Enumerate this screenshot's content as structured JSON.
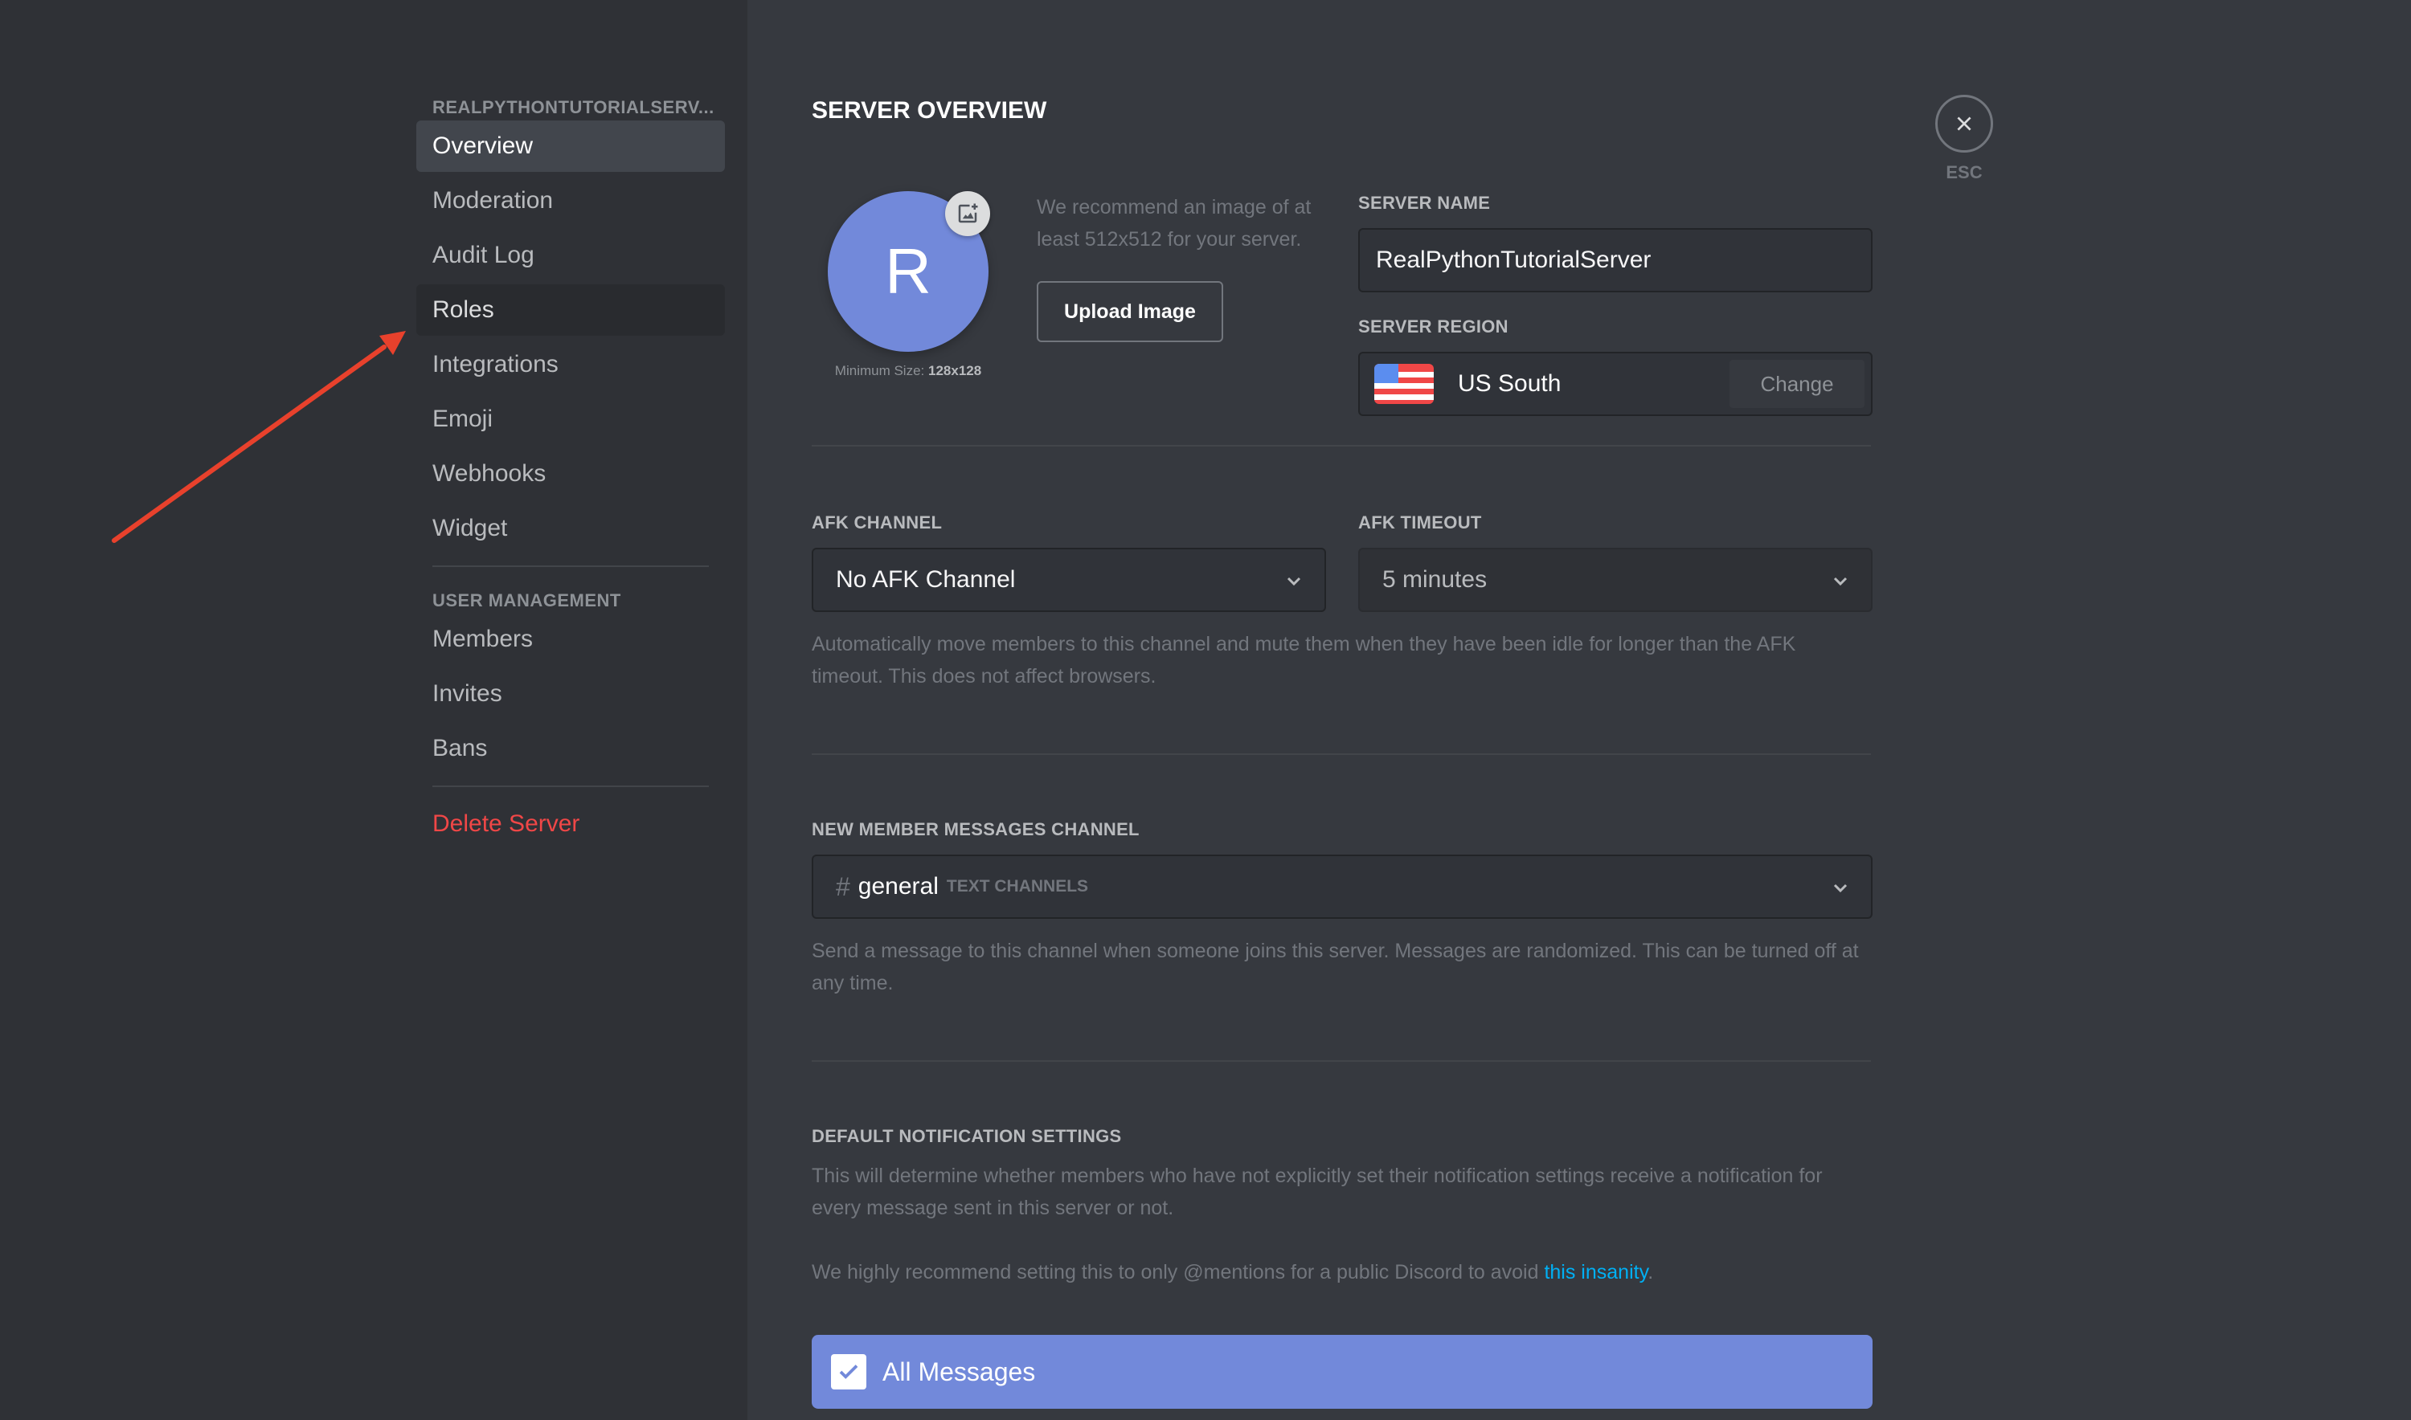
{
  "sidebar": {
    "server_header": "REALPYTHONTUTORIALSERV...",
    "items": [
      {
        "label": "Overview",
        "state": "selected"
      },
      {
        "label": "Moderation",
        "state": ""
      },
      {
        "label": "Audit Log",
        "state": ""
      },
      {
        "label": "Roles",
        "state": "hovered"
      },
      {
        "label": "Integrations",
        "state": ""
      },
      {
        "label": "Emoji",
        "state": ""
      },
      {
        "label": "Webhooks",
        "state": ""
      },
      {
        "label": "Widget",
        "state": ""
      }
    ],
    "user_management_header": "USER MANAGEMENT",
    "user_items": [
      {
        "label": "Members"
      },
      {
        "label": "Invites"
      },
      {
        "label": "Bans"
      }
    ],
    "delete_server": "Delete Server"
  },
  "main": {
    "title": "SERVER OVERVIEW",
    "avatar": {
      "initial": "R",
      "color": "#7289da",
      "upload_icon": "add-image-icon",
      "min_size_label": "Minimum Size:",
      "min_size_value": "128x128"
    },
    "upload": {
      "hint": "We recommend an image of at least 512x512 for your server.",
      "button": "Upload Image"
    },
    "server_name": {
      "label": "SERVER NAME",
      "value": "RealPythonTutorialServer"
    },
    "server_region": {
      "label": "SERVER REGION",
      "flag_icon": "us-flag-icon",
      "value": "US South",
      "change_button": "Change"
    },
    "afk": {
      "channel_label": "AFK CHANNEL",
      "channel_value": "No AFK Channel",
      "timeout_label": "AFK TIMEOUT",
      "timeout_value": "5 minutes",
      "help": "Automatically move members to this channel and mute them when they have been idle for longer than the AFK timeout. This does not affect browsers."
    },
    "new_member": {
      "label": "NEW MEMBER MESSAGES CHANNEL",
      "hash": "#",
      "channel": "general",
      "category": "TEXT CHANNELS",
      "help": "Send a message to this channel when someone joins this server. Messages are randomized. This can be turned off at any time."
    },
    "notifications": {
      "label": "DEFAULT NOTIFICATION SETTINGS",
      "help": "This will determine whether members who have not explicitly set their notification settings receive a notification for every message sent in this server or not.",
      "recommend_prefix": "We highly recommend setting this to only @mentions for a public Discord to avoid ",
      "recommend_link": "this insanity",
      "recommend_suffix": ".",
      "option_all_messages": "All Messages",
      "option_all_messages_checked": true
    }
  },
  "close": {
    "icon": "close-icon",
    "label": "ESC"
  },
  "annotation": {
    "arrow_color": "#e8412c",
    "points_to": "Roles"
  },
  "colors": {
    "accent": "#7289da",
    "danger": "#f04747",
    "link": "#00b0f4"
  }
}
